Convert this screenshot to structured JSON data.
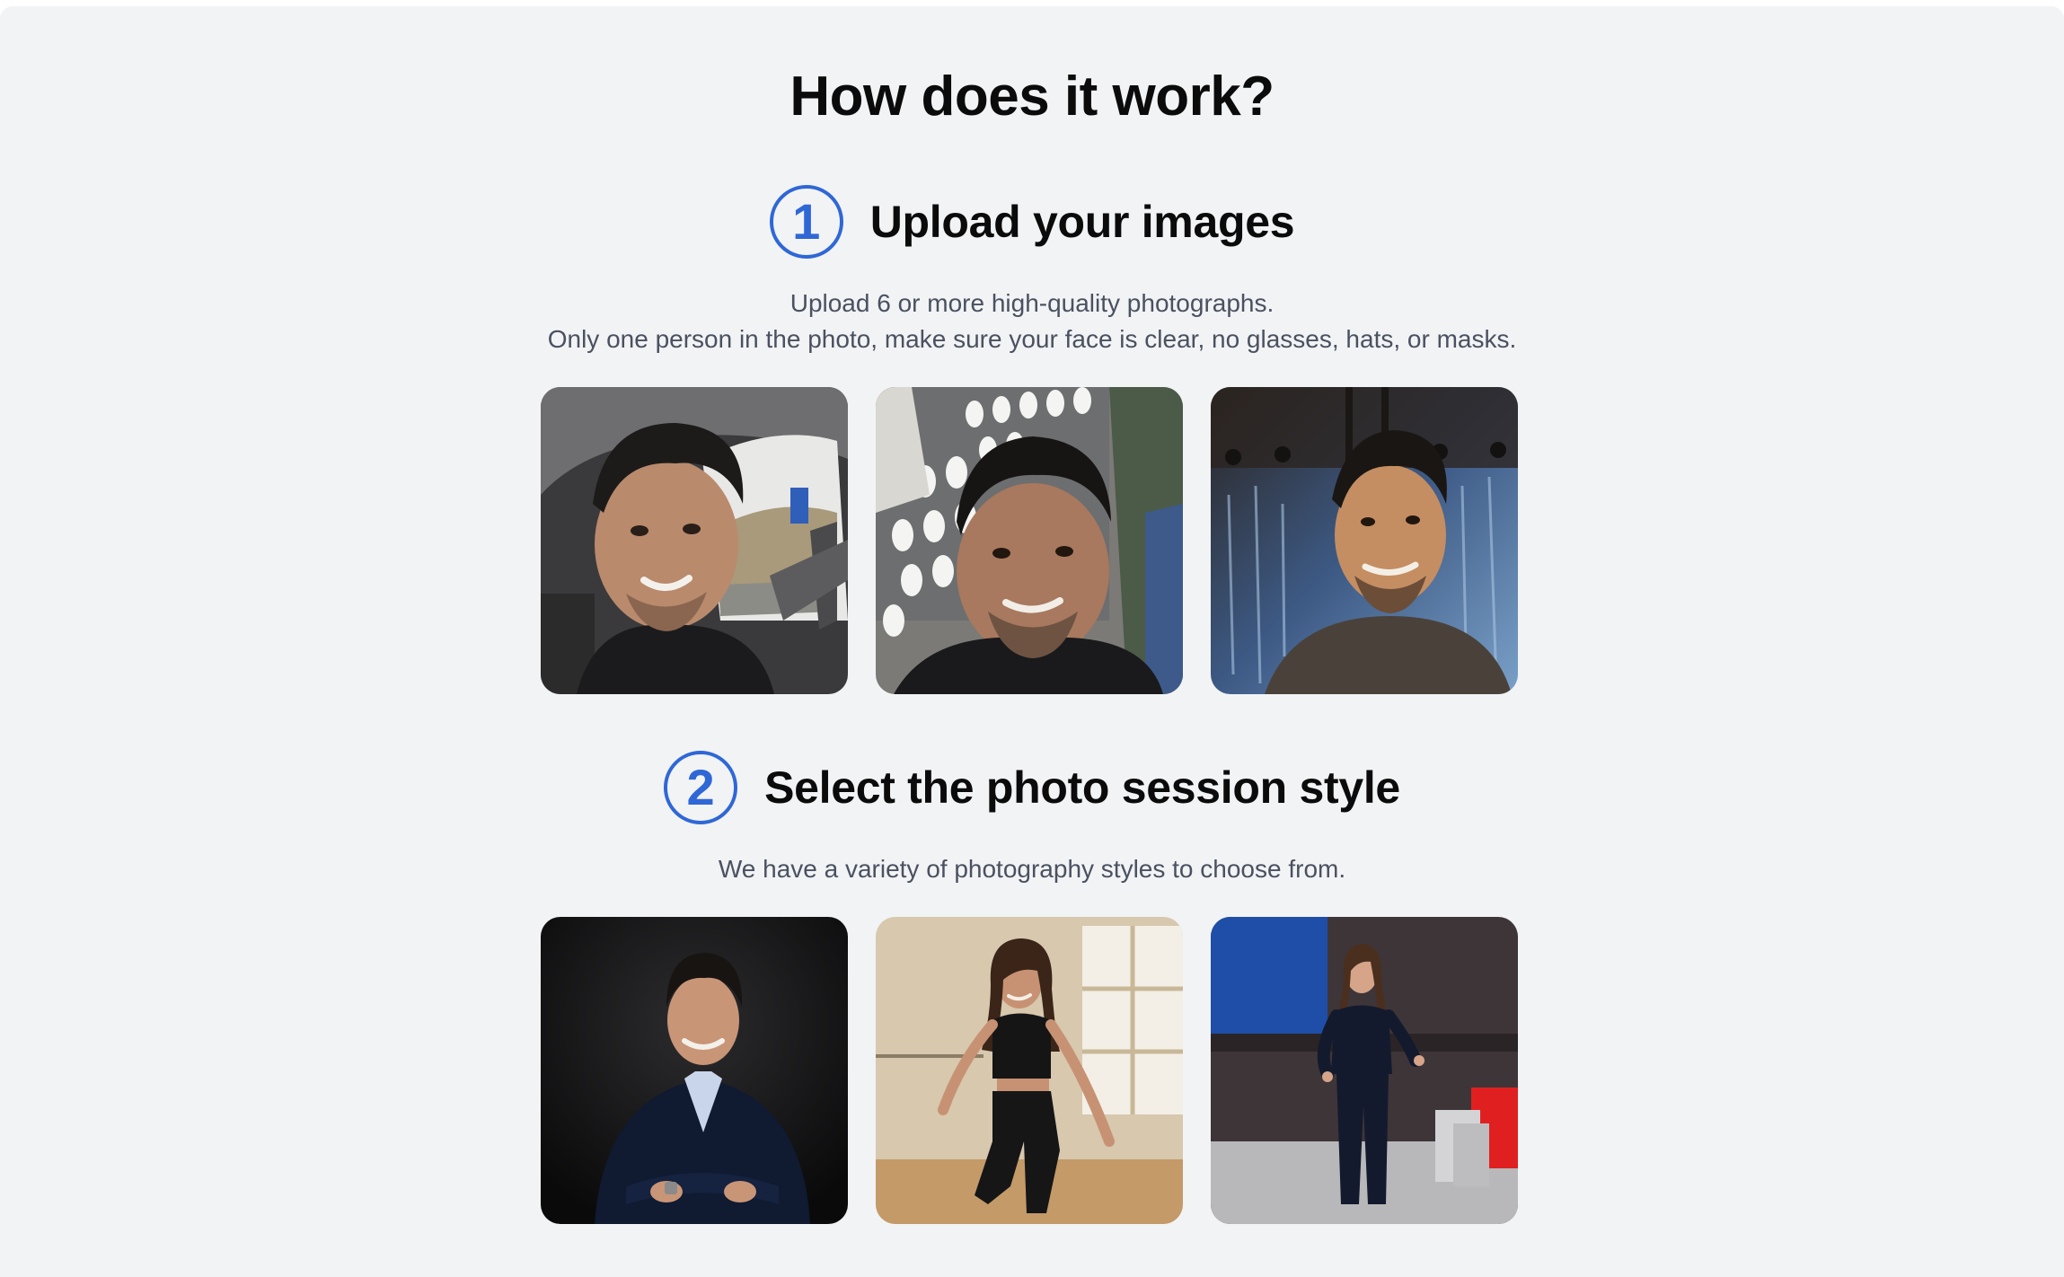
{
  "page": {
    "title": "How does it work?"
  },
  "steps": [
    {
      "number": "1",
      "title": "Upload your images",
      "description_line1": "Upload 6 or more high-quality photographs.",
      "description_line2": "Only one person in the photo, make sure your face is clear, no glasses, hats, or masks.",
      "photos": [
        {
          "subject": "selfie-in-car"
        },
        {
          "subject": "selfie-outdoors"
        },
        {
          "subject": "portrait-dark-wall"
        }
      ]
    },
    {
      "number": "2",
      "title": "Select the photo session style",
      "description_line1": "We have a variety of photography styles to choose from.",
      "photos": [
        {
          "subject": "business-portrait"
        },
        {
          "subject": "fitness-studio"
        },
        {
          "subject": "stage-speaker"
        }
      ]
    }
  ],
  "colors": {
    "accent": "#2f67d6",
    "background": "#f2f3f5",
    "heading": "#0b0b0b",
    "body_text": "#4a5160"
  }
}
